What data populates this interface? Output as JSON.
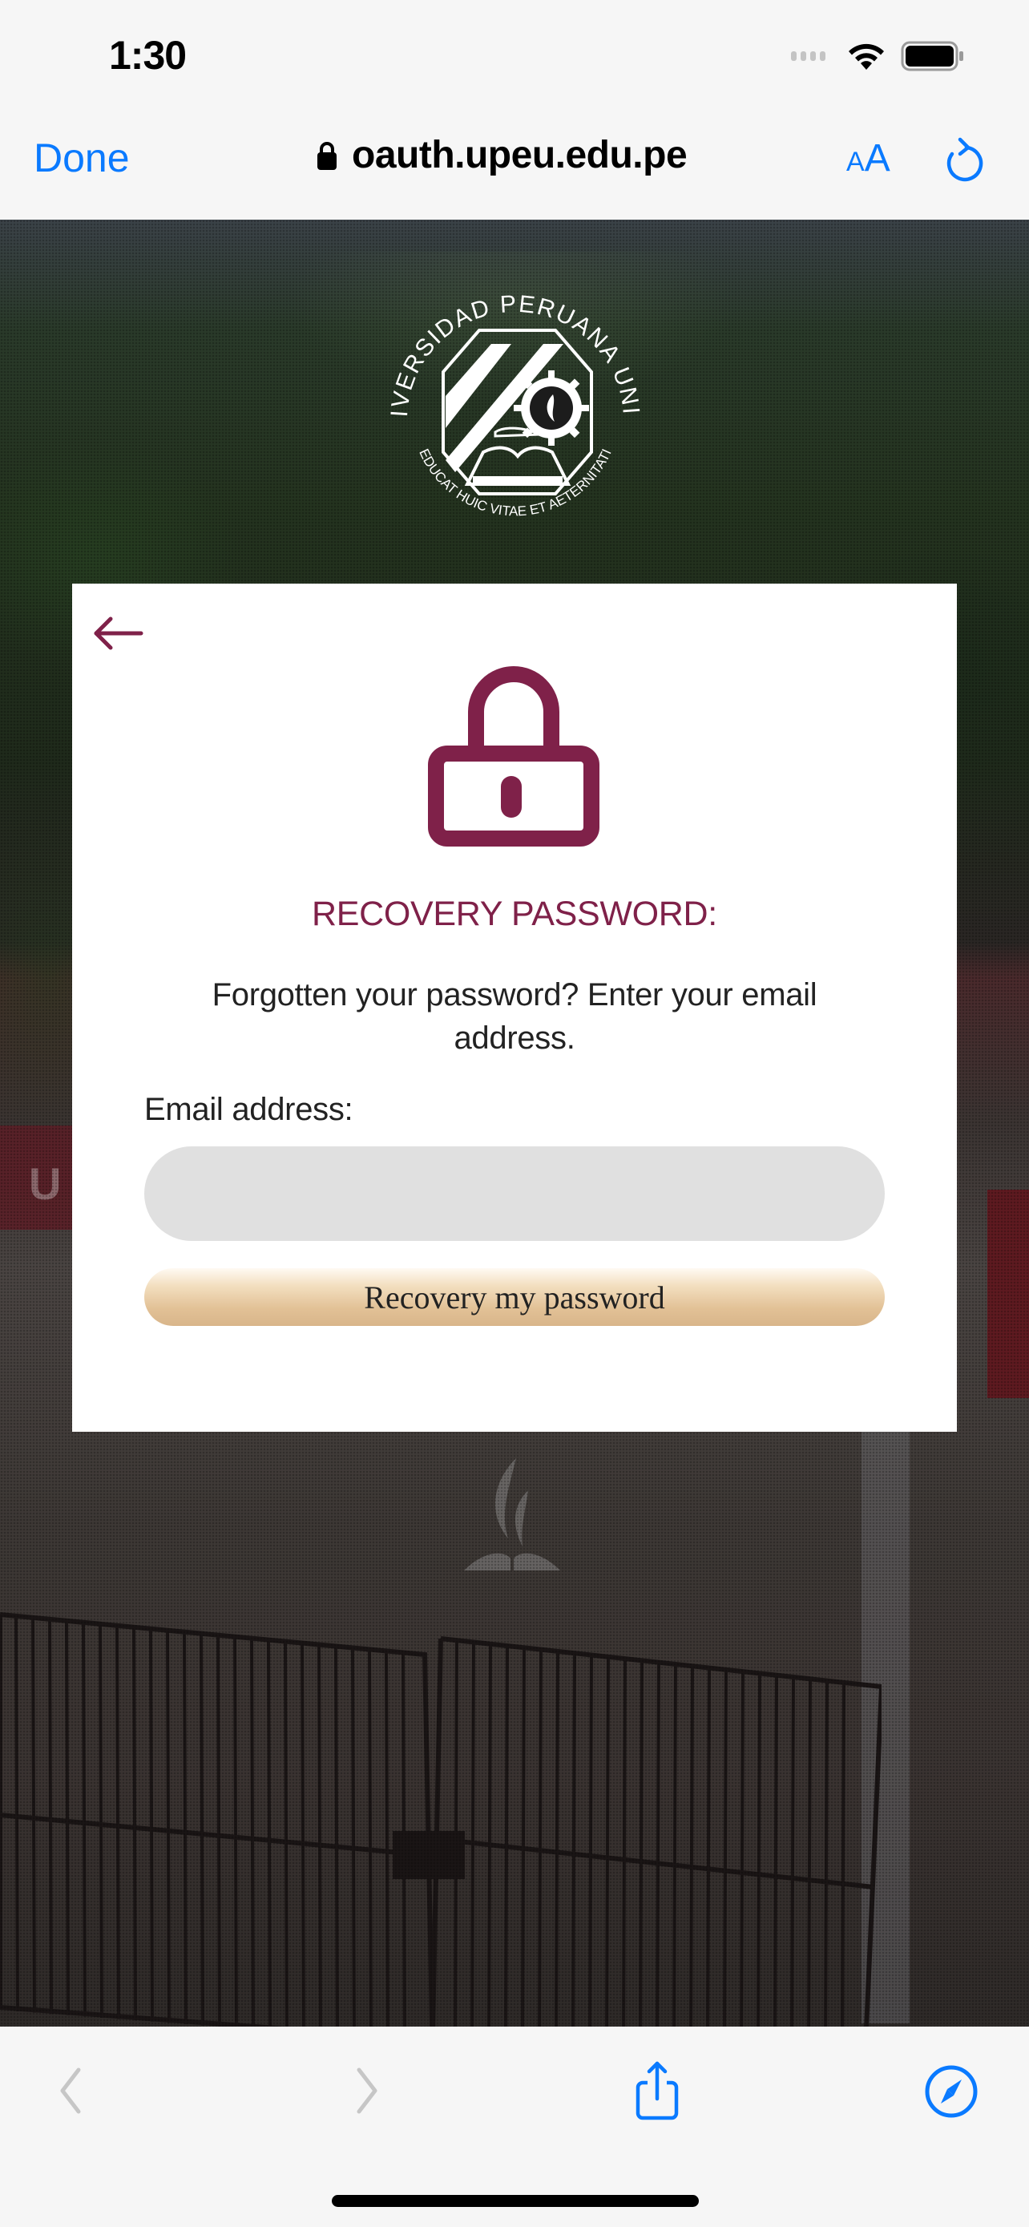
{
  "status_bar": {
    "time": "1:30",
    "icons": [
      "cellular-signal-icon",
      "wifi-icon",
      "battery-icon"
    ]
  },
  "browser": {
    "done_label": "Done",
    "url": "oauth.upeu.edu.pe",
    "secure_icon": "lock-icon",
    "text_size_small": "A",
    "text_size_big": "A",
    "reload_icon": "reload-icon",
    "accent_color": "#0a7aff"
  },
  "page": {
    "seal": {
      "top_text": "UNIVERSIDAD PERUANA UNION",
      "bottom_text": "EDUCAT HUIC VITAE ET AETERNITATI"
    },
    "background_sign_letter": "U",
    "card": {
      "back_icon": "arrow-left-icon",
      "lock_icon": "lock-icon",
      "title": "RECOVERY PASSWORD:",
      "description": "Forgotten your password? Enter your email address.",
      "email_label": "Email address:",
      "email_value": "",
      "email_placeholder": "",
      "submit_label": "Recovery my password",
      "brand_color": "#7f2149"
    }
  },
  "bottom_toolbar": {
    "items": [
      {
        "name": "back",
        "icon": "chevron-left-icon",
        "enabled": false
      },
      {
        "name": "forward",
        "icon": "chevron-right-icon",
        "enabled": false
      },
      {
        "name": "share",
        "icon": "share-icon",
        "enabled": true
      },
      {
        "name": "open-in-safari",
        "icon": "compass-icon",
        "enabled": true
      }
    ]
  }
}
